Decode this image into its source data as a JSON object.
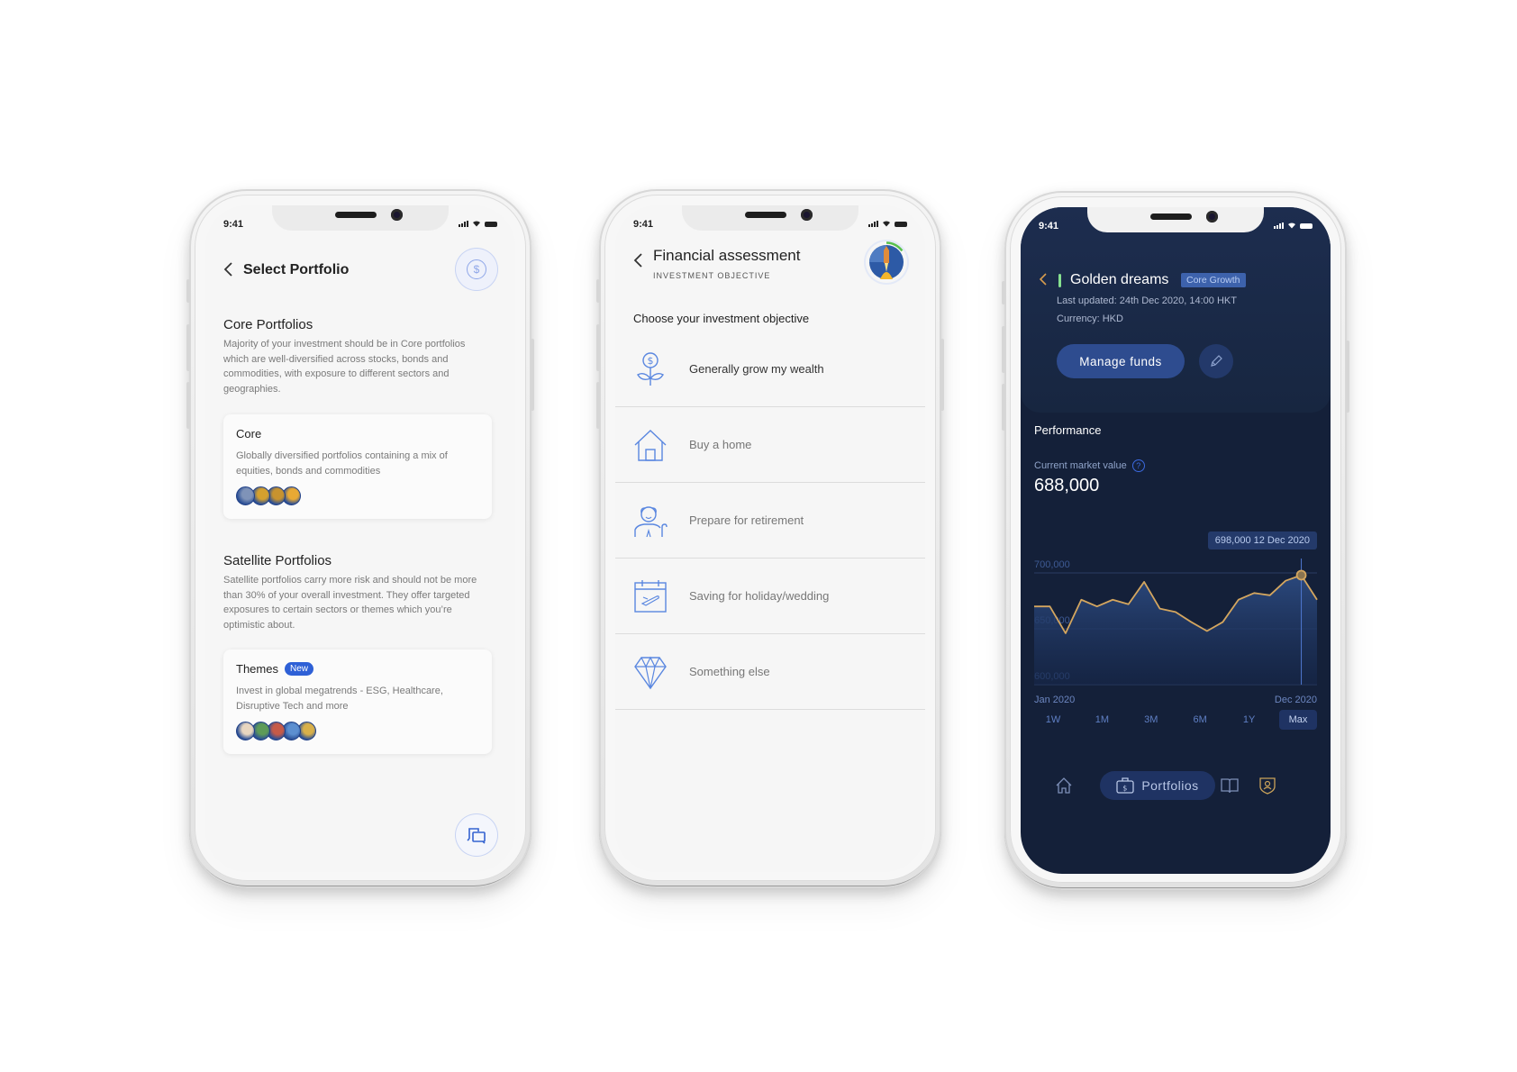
{
  "status_bar": {
    "time": "9:41"
  },
  "screen1": {
    "title": "Select Portfolio",
    "back_icon": "chevron-left-icon",
    "coin_icon": "dollar-coin-icon",
    "core_section": {
      "title": "Core Portfolios",
      "description": "Majority of your investment should be in Core portfolios which are well-diversified across stocks, bonds and commodities, with exposure to different sectors and geographies."
    },
    "core_card": {
      "title": "Core",
      "description": "Globally diversified portfolios containing a mix of equities, bonds and commodities",
      "avatar_colors": [
        "#7f93b8",
        "#d4a02e",
        "#c8932f",
        "#e8a934"
      ]
    },
    "satellite_section": {
      "title": "Satellite Portfolios",
      "description": "Satellite portfolios carry more risk and should not be more than 30% of your overall investment. They offer targeted exposures to certain sectors or themes which you’re optimistic about."
    },
    "themes_card": {
      "title": "Themes",
      "badge": "New",
      "description": "Invest in global megatrends - ESG, Healthcare, Disruptive Tech and more",
      "avatar_colors": [
        "#e8d6c0",
        "#5d9b58",
        "#c65a48",
        "#5c8fd0",
        "#d8b04a"
      ]
    },
    "chat_icon": "chat-bubbles-icon"
  },
  "screen2": {
    "title": "Financial assessment",
    "subtitle": "INVESTMENT OBJECTIVE",
    "progress": 0.15,
    "prompt": "Choose your investment objective",
    "objectives": [
      {
        "label": "Generally grow my wealth",
        "icon": "money-plant-icon"
      },
      {
        "label": "Buy a home",
        "icon": "house-icon"
      },
      {
        "label": "Prepare for retirement",
        "icon": "elderly-person-icon"
      },
      {
        "label": "Saving for holiday/wedding",
        "icon": "calendar-plane-icon"
      },
      {
        "label": "Something else",
        "icon": "diamond-icon"
      }
    ]
  },
  "screen3": {
    "title": "Golden dreams",
    "tag": "Core Growth",
    "last_updated": "Last updated: 24th Dec 2020, 14:00 HKT",
    "currency": "Currency: HKD",
    "manage_button": "Manage funds",
    "edit_icon": "pencil-icon",
    "performance_title": "Performance",
    "market_value_label": "Current market value",
    "market_value": "688,000",
    "tooltip": "698,000 12 Dec 2020",
    "ranges": [
      "1W",
      "1M",
      "3M",
      "6M",
      "1Y",
      "Max"
    ],
    "active_range": "Max",
    "nav": {
      "home_icon": "home-icon",
      "portfolios_label": "Portfolios",
      "portfolios_icon": "briefcase-dollar-icon",
      "learn_icon": "book-icon",
      "profile_icon": "shield-user-icon"
    },
    "colors": {
      "line": "#d4a65f",
      "accent": "#2e4c8f",
      "bg": "#142039"
    }
  },
  "chart_data": {
    "type": "area",
    "title": "Performance",
    "xlabel": "",
    "ylabel": "",
    "x_tick_labels": [
      "Jan 2020",
      "Dec 2020"
    ],
    "y_tick_labels": [
      "700,000",
      "650,000",
      "600,000"
    ],
    "yticks": [
      700000,
      650000,
      600000
    ],
    "ylim": [
      600000,
      700000
    ],
    "grid": true,
    "series": [
      {
        "name": "Market value",
        "values": [
          670000,
          670000,
          646000,
          676000,
          670000,
          676000,
          672000,
          692000,
          668000,
          665000,
          656000,
          648000,
          656000,
          676000,
          682000,
          680000,
          693000,
          698000,
          676000
        ]
      }
    ],
    "highlight": {
      "index": 17,
      "value": 698000,
      "label": "698,000 12 Dec 2020"
    }
  }
}
